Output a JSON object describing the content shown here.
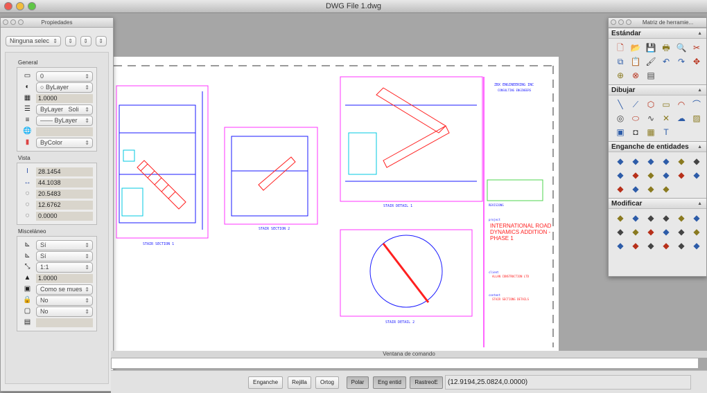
{
  "window": {
    "title": "DWG File 1.dwg"
  },
  "properties": {
    "title": "Propiedades",
    "selection": "Ninguna selec",
    "general_label": "General",
    "general": {
      "layer": "0",
      "color": "ByLayer",
      "linetype_scale": "1.0000",
      "linetype": "ByLayer",
      "linetype_style": "Soli",
      "lineweight": "ByLayer",
      "hyperlink": "",
      "plotstyle": "ByColor"
    },
    "vista_label": "Vista",
    "vista": [
      "28.1454",
      "44.1038",
      "20.5483",
      "12.6762",
      "0.0000"
    ],
    "misc_label": "Misceláneo",
    "misc": {
      "ucs_on": "Sí",
      "ucs_origin": "Sí",
      "scale": "1:1",
      "annot_scale": "1.0000",
      "display": "Como se mues",
      "lock": "No",
      "ucs_per_vp": "No",
      "ucs_name": ""
    }
  },
  "toolbox": {
    "title": "Matriz de herramie...",
    "sections": [
      {
        "label": "Estándar",
        "icons": [
          "new-icon",
          "open-icon",
          "save-icon",
          "print-icon",
          "preview-icon",
          "cut-icon",
          "copy-icon",
          "paste-icon",
          "match-prop-icon",
          "undo-icon",
          "redo-icon",
          "pan-icon",
          "zoom-realtime-icon",
          "zoom-window-icon",
          "layers-icon"
        ]
      },
      {
        "label": "Dibujar",
        "icons": [
          "line-icon",
          "polyline-icon",
          "polygon-icon",
          "rectangle-icon",
          "arc-icon",
          "arc3-icon",
          "circle-icon",
          "ellipse-icon",
          "spline-icon",
          "point-icon",
          "revcloud-icon",
          "hatch-icon",
          "insert-block-icon",
          "region-icon",
          "table-icon",
          "text-icon"
        ]
      },
      {
        "label": "Enganche de entidades",
        "icons": [
          "endpoint-icon",
          "midpoint-icon",
          "intersection-icon",
          "apparent-int-icon",
          "extension-icon",
          "center-icon",
          "quadrant-icon",
          "tangent-icon",
          "perpendicular-icon",
          "parallel-icon",
          "insert-snap-icon",
          "node-icon",
          "nearest-icon",
          "none-icon",
          "settings-snap-icon",
          "snap-from-icon"
        ]
      },
      {
        "label": "Modificar",
        "icons": [
          "erase-icon",
          "copy-obj-icon",
          "mirror-icon",
          "offset-icon",
          "array-icon",
          "move-icon",
          "rotate-icon",
          "scale-icon",
          "stretch-icon",
          "trim-icon",
          "extend-icon",
          "break-icon",
          "join-icon",
          "chamfer-icon",
          "fillet-icon",
          "explode-icon",
          "properties-icon",
          "edit-icon"
        ]
      }
    ]
  },
  "drawing": {
    "labels": [
      "STAIR SECTION 1",
      "STAIR SECTION 2",
      "STAIR DETAIL 1",
      "STAIR DETAIL 2"
    ],
    "titleblock": {
      "company": "ZBX ENGINEERING INC",
      "subtitle": "CONSULTING ENGINEERS",
      "revisions": "REVISIONS",
      "project_label": "project",
      "project": "INTERNATIONAL ROAD DYNAMICS ADDITION - PHASE 1",
      "client_label": "client",
      "client": "ALLAN CONSTRUCTION LTD",
      "content_label": "content",
      "content": "STAIR SECTIONS DETAILS"
    }
  },
  "command": {
    "label": "Ventana de comando",
    "value": ""
  },
  "status": {
    "buttons": [
      {
        "label": "Enganche",
        "on": false
      },
      {
        "label": "Rejilla",
        "on": false
      },
      {
        "label": "Ortog",
        "on": false
      },
      {
        "label": "Polar",
        "on": true
      },
      {
        "label": "Eng entid",
        "on": true
      },
      {
        "label": "RastreoE",
        "on": true
      }
    ],
    "coords": "(12.9194,25.0824,0.0000)"
  },
  "colors": {
    "magenta": "#ff33ff",
    "red": "#ff2020",
    "blue": "#1a1aff",
    "cyan": "#00c8e0",
    "green": "#4cd44c"
  }
}
